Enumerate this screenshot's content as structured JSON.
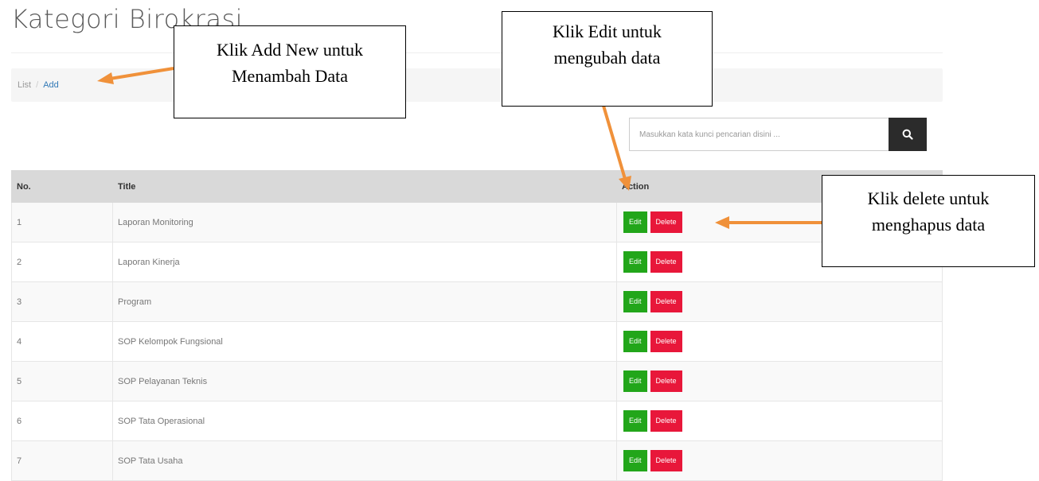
{
  "page": {
    "title": "Kategori Birokrasi"
  },
  "breadcrumb": {
    "list_label": "List",
    "separator": "/",
    "add_label": "Add"
  },
  "search": {
    "placeholder": "Masukkan kata kunci pencarian disini ...",
    "value": "",
    "icon": "search-icon"
  },
  "table": {
    "headers": {
      "no": "No.",
      "title": "Title",
      "action": "Action"
    },
    "rows": [
      {
        "no": "1",
        "title": "Laporan Monitoring"
      },
      {
        "no": "2",
        "title": "Laporan Kinerja"
      },
      {
        "no": "3",
        "title": "Program"
      },
      {
        "no": "4",
        "title": "SOP Kelompok Fungsional"
      },
      {
        "no": "5",
        "title": "SOP Pelayanan Teknis"
      },
      {
        "no": "6",
        "title": "SOP Tata Operasional"
      },
      {
        "no": "7",
        "title": "SOP Tata Usaha"
      }
    ],
    "edit_label": "Edit",
    "delete_label": "Delete"
  },
  "callouts": {
    "add_new": [
      "Klik Add New untuk",
      "Menambah Data"
    ],
    "edit": [
      "Klik Edit untuk",
      "mengubah data"
    ],
    "delete": [
      "Klik delete untuk",
      "menghapus data"
    ]
  },
  "colors": {
    "edit_button": "#22a61a",
    "delete_button": "#e8173a",
    "arrow": "#f0913a",
    "header_bg": "#d9d9d9",
    "search_button": "#2b2b2b"
  }
}
